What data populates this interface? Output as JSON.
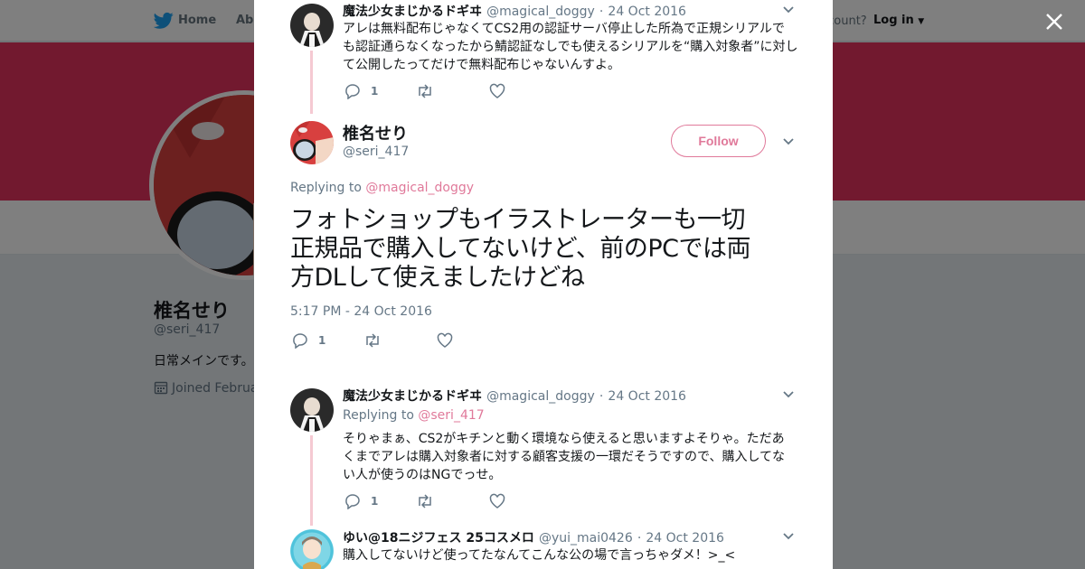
{
  "nav": {
    "home": "Home",
    "about": "Abo",
    "account": "account?",
    "login": "Log in"
  },
  "profile": {
    "name": "椎名せり",
    "handle": "@seri_417",
    "bio": "日常メインです。",
    "joined": "Joined Februa"
  },
  "tweets": {
    "prev": {
      "name": "魔法少女まじかるドギヰ",
      "handle": "@magical_doggy",
      "date": "24 Oct 2016",
      "lines": [
        "アレは無料配布じゃなくてCS2用の認証サーバ停止した所為で正規シリアルで",
        "も認証通らなくなったから鯖認証なしでも使えるシリアルを“購入対象者”に対し",
        "て公開したってだけで無料配布じゃないんすよ。"
      ],
      "reply_count": "1"
    },
    "main": {
      "name": "椎名せり",
      "handle": "@seri_417",
      "follow_label": "Follow",
      "replying_label": "Replying to",
      "replying_to": "@magical_doggy",
      "lines": [
        "フォトショップもイラストレーターも一切",
        "正規品で購入してないけど、前のPCでは両",
        "方DLして使えましたけどね"
      ],
      "timestamp": "5:17 PM - 24 Oct 2016",
      "reply_count": "1"
    },
    "reply1": {
      "name": "魔法少女まじかるドギヰ",
      "handle": "@magical_doggy",
      "date": "24 Oct 2016",
      "replying_label": "Replying to",
      "replying_to": "@seri_417",
      "lines": [
        "そりゃまぁ、CS2がキチンと動く環境なら使えると思いますよそりゃ。ただあ",
        "くまでアレは購入対象者に対する顧客支援の一環だそうですので、購入してな",
        "い人が使うのはNGでっせ。"
      ],
      "reply_count": "1"
    },
    "reply2": {
      "name": "ゆい@18ニジフェス 25コスメロ",
      "handle": "@yui_mai0426",
      "date": "24 Oct 2016",
      "lines": [
        "購入してないけど使ってたなんてこんな公の場で言っちゃダメ！>_<"
      ]
    }
  },
  "colors": {
    "accent": "#e0799a",
    "banner": "#e5335f",
    "thread_line": "#f5c9d2",
    "twitter_blue": "#1da1f2"
  },
  "icons": [
    "twitter-bird-icon",
    "close-icon",
    "chevron-down-icon",
    "reply-icon",
    "retweet-icon",
    "like-icon",
    "calendar-icon"
  ]
}
